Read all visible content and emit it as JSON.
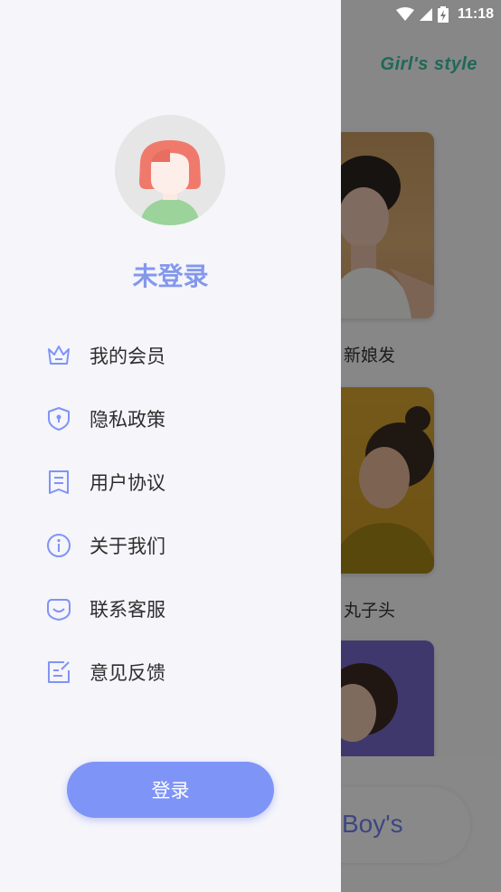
{
  "status_bar": {
    "time": "11:18",
    "icons": [
      "wifi-icon",
      "signal-icon",
      "battery-icon"
    ]
  },
  "background": {
    "title": "Girl's style",
    "cards": [
      {
        "label": "新娘发",
        "label_visible": "新娘发"
      },
      {
        "label": "丸子头",
        "label_visible": "丸子头"
      }
    ],
    "bottom_tab_right": "Boy's"
  },
  "drawer": {
    "login_status": "未登录",
    "menu": [
      {
        "label": "我的会员",
        "icon": "crown-icon"
      },
      {
        "label": "隐私政策",
        "icon": "shield-icon"
      },
      {
        "label": "用户协议",
        "icon": "document-icon"
      },
      {
        "label": "关于我们",
        "icon": "info-icon"
      },
      {
        "label": "联系客服",
        "icon": "customer-service-icon"
      },
      {
        "label": "意见反馈",
        "icon": "feedback-icon"
      }
    ],
    "login_button": "登录"
  },
  "colors": {
    "accent": "#7f94f7",
    "accent_text": "#8398ec",
    "style_title": "#3bbd9c"
  }
}
